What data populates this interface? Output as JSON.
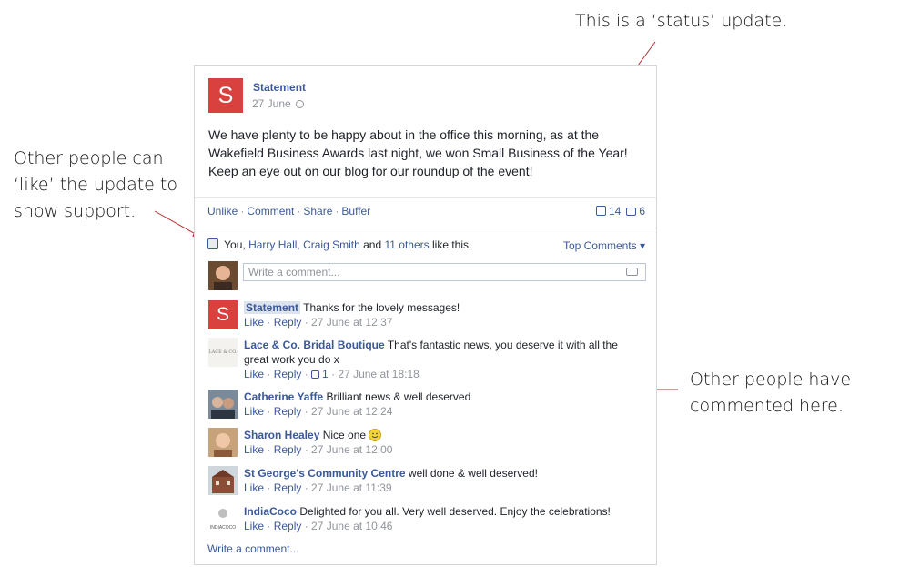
{
  "annotations": {
    "status": "This is a ‘status’ update.",
    "like_line1": "Other people can",
    "like_line2": "‘like’ the update to",
    "like_line3": "show support.",
    "comments_line1": "Other people have",
    "comments_line2": "commented here."
  },
  "post": {
    "avatar_letter": "S",
    "author": "Statement",
    "date": "27 June",
    "text": "We have plenty to be happy about in the office this morning, as at the Wakefield Business Awards last night, we won Small Business of the Year! Keep an eye out on our blog for our roundup of the event!",
    "actions": [
      "Unlike",
      "Comment",
      "Share",
      "Buffer"
    ],
    "like_count": "14",
    "comment_count": "6"
  },
  "likes": {
    "you": "You,",
    "names": "Harry Hall, Craig Smith",
    "and": "and",
    "others": "11 others",
    "suffix": "like this.",
    "top_comments": "Top Comments ▾"
  },
  "comment_box": {
    "placeholder": "Write a comment..."
  },
  "comments": [
    {
      "author": "Statement",
      "text": "Thanks for the lovely messages!",
      "like": "Like",
      "reply": "Reply",
      "likes": "",
      "time": "27 June at 12:37"
    },
    {
      "author": "Lace & Co. Bridal Boutique",
      "text": "That's fantastic news, you deserve it with all the great work you do x",
      "like": "Like",
      "reply": "Reply",
      "likes": "1",
      "time": "27 June at 18:18"
    },
    {
      "author": "Catherine Yaffe",
      "text": "Brilliant news & well deserved",
      "like": "Like",
      "reply": "Reply",
      "likes": "",
      "time": "27 June at 12:24"
    },
    {
      "author": "Sharon Healey",
      "text": "Nice one",
      "like": "Like",
      "reply": "Reply",
      "likes": "",
      "time": "27 June at 12:00"
    },
    {
      "author": "St George's Community Centre",
      "text": "well done & well deserved!",
      "like": "Like",
      "reply": "Reply",
      "likes": "",
      "time": "27 June at 11:39"
    },
    {
      "author": "IndiaCoco",
      "text": "Delighted for you all. Very well deserved. Enjoy the celebrations!",
      "like": "Like",
      "reply": "Reply",
      "likes": "",
      "time": "27 June at 10:46"
    }
  ],
  "avatar_labels": {
    "lace": "LACE & CO.",
    "indiacoco": "INDIACOCO"
  },
  "write_more": "Write a comment...",
  "colors": {
    "brand_red": "#d9413f",
    "link_blue": "#3b5998",
    "arrow_red": "#b22b2b"
  }
}
